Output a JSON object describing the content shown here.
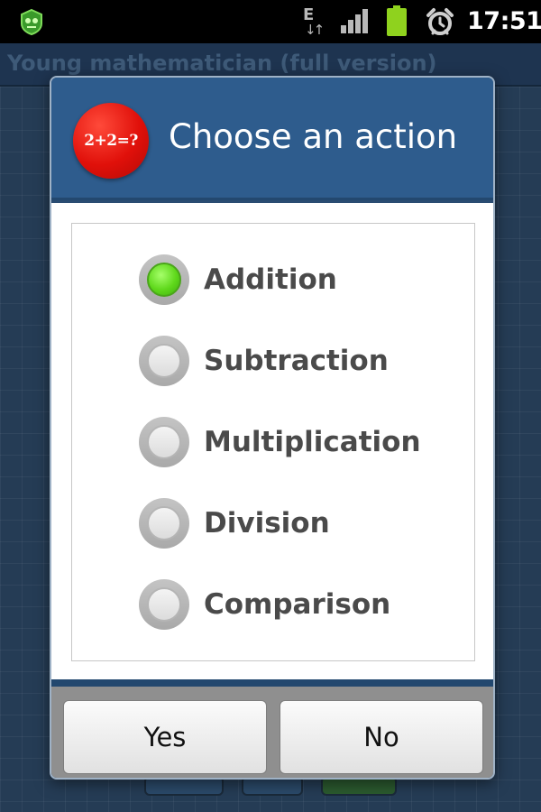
{
  "status_bar": {
    "network_type": "E",
    "data_arrows": "↓↑",
    "time": "17:51",
    "icons": [
      "app-notification-icon",
      "network-type-icon",
      "signal-icon",
      "battery-icon",
      "alarm-icon"
    ],
    "battery_color": "#8fd21e"
  },
  "app": {
    "title": "Young mathematician (full version)"
  },
  "dialog": {
    "logo_text": "2+2=?",
    "title": "Choose an action",
    "options": [
      {
        "label": "Addition",
        "checked": true
      },
      {
        "label": "Subtraction",
        "checked": false
      },
      {
        "label": "Multiplication",
        "checked": false
      },
      {
        "label": "Division",
        "checked": false
      },
      {
        "label": "Comparison",
        "checked": false
      }
    ],
    "buttons": {
      "yes": "Yes",
      "no": "No"
    }
  },
  "colors": {
    "header": "#2e5c8d",
    "radio_checked": "#5fd81b",
    "logo": "#e0100a"
  }
}
